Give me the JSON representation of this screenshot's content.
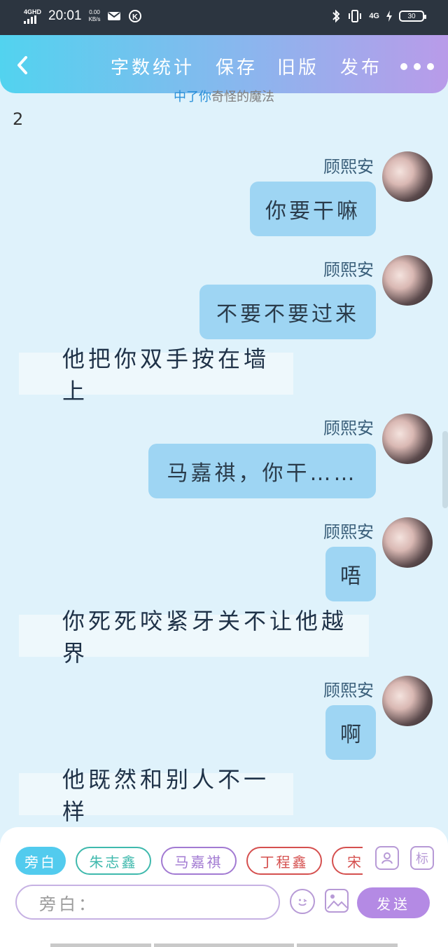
{
  "status_bar": {
    "network": "4GHD",
    "time": "20:01",
    "speed_value": "0.00",
    "speed_unit": "KB/s",
    "net_right": "4G",
    "battery": "30"
  },
  "header": {
    "back_icon": "chevron-left-icon",
    "word_count": "字数统计",
    "save": "保存",
    "old_version": "旧版",
    "publish": "发布",
    "more_icon": "ellipsis-icon",
    "chapter_highlight": "中了你",
    "chapter_rest": "奇怪的魔法"
  },
  "page_number": "2",
  "messages": [
    {
      "type": "speech",
      "speaker": "顾熙安",
      "text": "你要干嘛"
    },
    {
      "type": "speech",
      "speaker": "顾熙安",
      "text": "不要不要过来"
    },
    {
      "type": "narration",
      "text": "他把你双手按在墙上"
    },
    {
      "type": "speech",
      "speaker": "顾熙安",
      "text": "马嘉祺，你干……"
    },
    {
      "type": "speech",
      "speaker": "顾熙安",
      "text": "唔"
    },
    {
      "type": "narration",
      "text": "你死死咬紧牙关不让他越界"
    },
    {
      "type": "speech",
      "speaker": "顾熙安",
      "text": "啊"
    },
    {
      "type": "narration",
      "text": "他既然和别人不一样"
    }
  ],
  "roles": [
    {
      "label": "旁白",
      "color": "#52cbee",
      "active": true
    },
    {
      "label": "朱志鑫",
      "color": "#3fb9ad",
      "active": false
    },
    {
      "label": "马嘉祺",
      "color": "#a27ad2",
      "active": false
    },
    {
      "label": "丁程鑫",
      "color": "#d5504f",
      "active": false
    },
    {
      "label": "宋",
      "color": "#d5504f",
      "active": false
    }
  ],
  "tools": {
    "character_icon": "person-card-icon",
    "tag_label": "标",
    "input_placeholder": "旁白：",
    "emoji_icon": "smiley-icon",
    "image_icon": "image-icon",
    "send": "发送"
  }
}
